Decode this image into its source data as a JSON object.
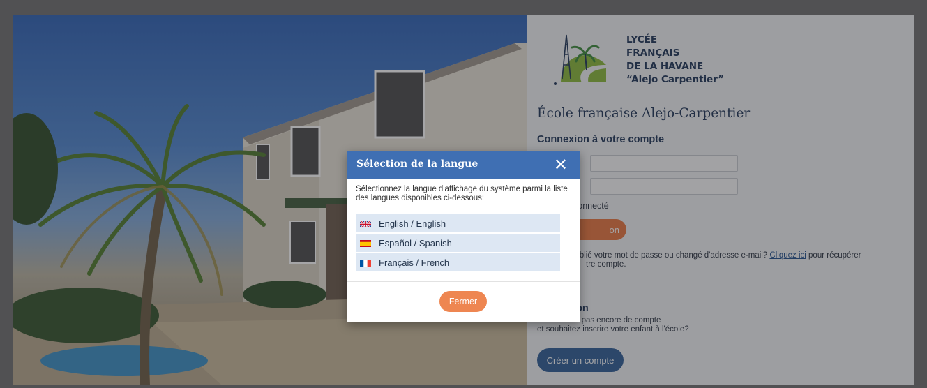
{
  "colors": {
    "modal_header": "#3f6fb3",
    "accent_orange": "#ee8651",
    "primary_blue": "#2f5d96",
    "heading_navy": "#1e3556"
  },
  "school": {
    "logo_icon": "palm-tree-logo-icon",
    "name_lines": [
      "LYCÉE",
      "FRANÇAIS",
      "DE LA HAVANE",
      "“Alejo Carpentier”"
    ]
  },
  "login": {
    "page_title": "École française Alejo-Carpentier",
    "section_title": "Connexion à votre compte",
    "stay_connected_label": "connecté",
    "login_button_label": "on",
    "forgot_text_before": "oublié votre mot de passe ou changé d'adresse e-mail?",
    "forgot_link": "Cliquez ici",
    "forgot_text_after": "pour récupérer",
    "forgot_text_line2": "tre compte."
  },
  "signup": {
    "title": "on",
    "line1": "vous n'avez pas encore de compte",
    "line2": "et souhaitez inscrire votre enfant à l'école?",
    "create_button_label": "Créer un compte"
  },
  "modal": {
    "title": "Sélection de la langue",
    "close_icon": "close-icon",
    "description": "Sélectionnez la langue d'affichage du système parmi la liste des langues disponibles ci-dessous:",
    "languages": [
      {
        "label": "English / English",
        "flag": "uk-flag-icon"
      },
      {
        "label": "Español / Spanish",
        "flag": "spain-flag-icon"
      },
      {
        "label": "Français / French",
        "flag": "france-flag-icon"
      }
    ],
    "close_button_label": "Fermer"
  }
}
